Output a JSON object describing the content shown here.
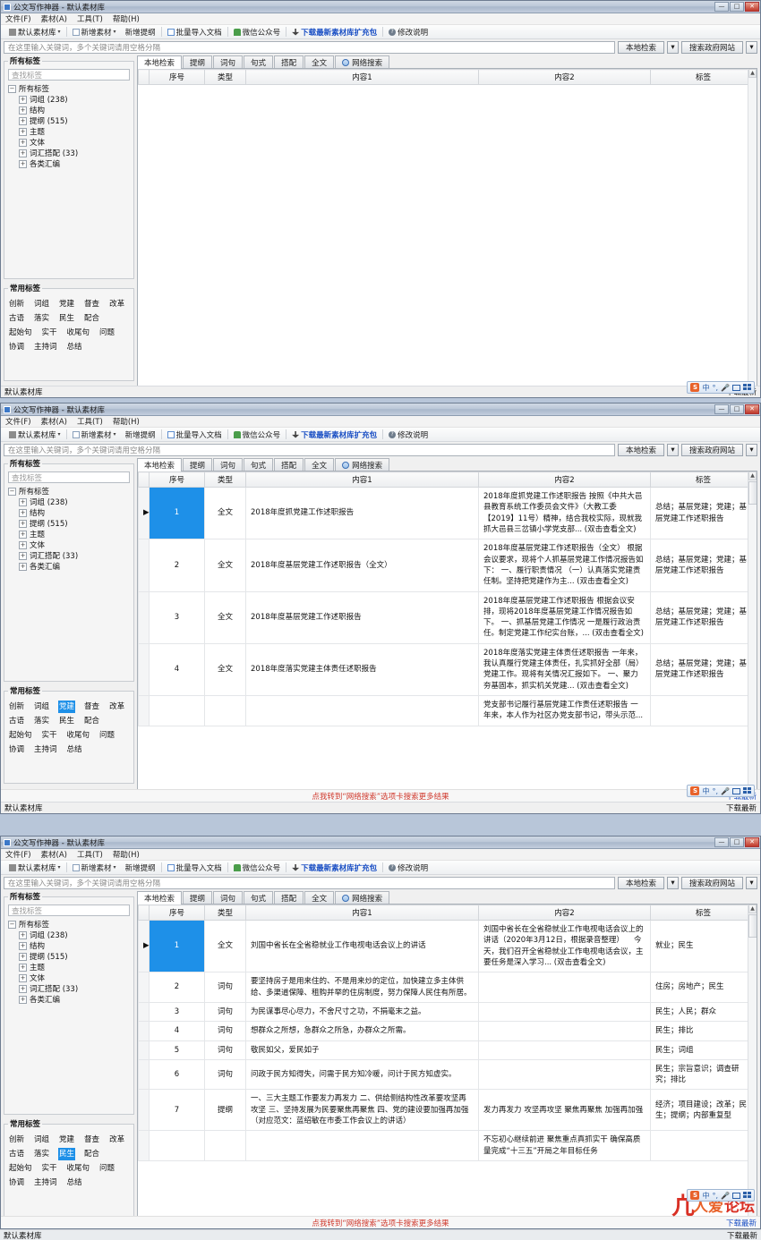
{
  "app": {
    "title": "公文写作神器 - 默认素材库",
    "window_buttons": {
      "minimize": "—",
      "maximize": "□",
      "close": "✕"
    }
  },
  "menu": {
    "items": [
      "文件(F)",
      "素材(A)",
      "工具(T)",
      "帮助(H)"
    ]
  },
  "toolbar": {
    "items": [
      {
        "label": "默认素材库",
        "icon": "library-icon",
        "caret": "▾"
      },
      {
        "label": "新增素材",
        "icon": "new-material-icon",
        "caret": "▾"
      },
      {
        "label": "新增提纲",
        "icon": "new-outline-icon",
        "caret": ""
      },
      {
        "label": "批量导入文档",
        "icon": "batch-import-icon",
        "caret": ""
      },
      {
        "label": "微信公众号",
        "icon": "wechat-icon",
        "caret": ""
      },
      {
        "label": "下载最新素材库扩充包",
        "icon": "download-icon",
        "caret": ""
      },
      {
        "label": "修改说明",
        "icon": "help-icon",
        "caret": ""
      }
    ]
  },
  "search": {
    "placeholder": "在这里输入关键词，多个关键词请用空格分隔",
    "value": "",
    "local_button": "本地检索",
    "gov_button": "搜索政府网站",
    "split_caret": "▾"
  },
  "sidebar": {
    "all_tags_title": "所有标签",
    "find_placeholder": "查找标签",
    "tree": {
      "root": {
        "label": "所有标签",
        "expander": "−"
      },
      "children": [
        {
          "label": "词组  (238)",
          "expander": "+"
        },
        {
          "label": "结构",
          "expander": "+"
        },
        {
          "label": "提纲  (515)",
          "expander": "+"
        },
        {
          "label": "主题",
          "expander": "+"
        },
        {
          "label": "文体",
          "expander": "+"
        },
        {
          "label": "词汇搭配  (33)",
          "expander": "+"
        },
        {
          "label": "各类汇编",
          "expander": "+"
        }
      ]
    },
    "common_title": "常用标签",
    "common_tags": [
      "创新",
      "词组",
      "党建",
      "督查",
      "改革",
      "古语",
      "落实",
      "民生",
      "配合",
      "起始句",
      "实干",
      "收尾句",
      "问题",
      "协调",
      "主持词",
      "总结"
    ],
    "selected_tag_win2": "党建",
    "selected_tag_win3": "民生"
  },
  "tabs": [
    {
      "label": "本地检索",
      "active": true,
      "icon": ""
    },
    {
      "label": "提纲",
      "active": false,
      "icon": ""
    },
    {
      "label": "词句",
      "active": false,
      "icon": ""
    },
    {
      "label": "句式",
      "active": false,
      "icon": ""
    },
    {
      "label": "搭配",
      "active": false,
      "icon": ""
    },
    {
      "label": "全文",
      "active": false,
      "icon": ""
    },
    {
      "label": "网络搜索",
      "active": false,
      "icon": "globe-icon"
    }
  ],
  "table": {
    "columns": [
      "序号",
      "类型",
      "内容1",
      "内容2",
      "标签"
    ]
  },
  "window1": {
    "rows": []
  },
  "window2": {
    "rows": [
      {
        "index": "1",
        "type": "全文",
        "content1": "2018年度抓党建工作述职报告",
        "content2": "2018年度抓党建工作述职报告\n按照《中共大邑县教育系统工作委员会文件》（大教工委【2019】11号）精神，结合我校实际，现就我抓大邑县三岔镇小学党支部...\n(双击查看全文)",
        "tags": "总结；基层党建；党建；基层党建工作述职报告",
        "selected": true
      },
      {
        "index": "2",
        "type": "全文",
        "content1": "2018年度基层党建工作述职报告（全文）",
        "content2": "2018年度基层党建工作述职报告（全文）\n根据会议要求，现将个人抓基层党建工作情况报告如下：\n一、履行职责情况\n（一）认真落实党建责任制。坚持把党建作为主...\n(双击查看全文)",
        "tags": "总结；基层党建；党建；基层党建工作述职报告",
        "selected": false
      },
      {
        "index": "3",
        "type": "全文",
        "content1": "2018年度基层党建工作述职报告",
        "content2": "2018年度基层党建工作述职报告\n根据会议安排，现将2018年度基层党建工作情况报告如下。\n一、抓基层党建工作情况\n一是履行政治责任。制定党建工作纪实台账，...\n(双击查看全文)",
        "tags": "总结；基层党建；党建；基层党建工作述职报告",
        "selected": false
      },
      {
        "index": "4",
        "type": "全文",
        "content1": "2018年度落实党建主体责任述职报告",
        "content2": "2018年度落实党建主体责任述职报告\n一年来，我认真履行党建主体责任，扎实抓好全部（局）党建工作。现将有关情况汇报如下。\n一、聚力夯基固本，抓实机关党建...\n(双击查看全文)",
        "tags": "总结；基层党建；党建；基层党建工作述职报告",
        "selected": false
      },
      {
        "index": "",
        "type": "",
        "content1": "",
        "content2": "党支部书记履行基层党建工作责任述职报告\n一年来，本人作为社区办党支部书记，带头示范...",
        "tags": "",
        "selected": false
      }
    ],
    "ad_text": "点我转到“网络搜索”选项卡搜索更多结果",
    "ad_right": "下载最新"
  },
  "window3": {
    "rows": [
      {
        "index": "1",
        "type": "全文",
        "content1": "刘国中省长在全省稳就业工作电视电话会议上的讲话",
        "content2": "刘国中省长在全省稳就业工作电视电话会议上的讲话（2020年3月12日，根据录音整理）\n　今天，我们召开全省稳就业工作电视电话会议，主要任务是深入学习...\n(双击查看全文)",
        "tags": "就业；民生",
        "selected": true
      },
      {
        "index": "2",
        "type": "词句",
        "content1": "要坚持房子是用来住的、不是用来炒的定位，加快建立多主体供给、多渠道保障、租购并举的住房制度，努力保障人民住有所居。",
        "content2": "",
        "tags": "住房；房地产；民生",
        "selected": false
      },
      {
        "index": "3",
        "type": "词句",
        "content1": "为民谋事尽心尽力，不舍尺寸之功，不捐毫末之益。",
        "content2": "",
        "tags": "民生；人民；群众",
        "selected": false
      },
      {
        "index": "4",
        "type": "词句",
        "content1": "想群众之所想，急群众之所急，办群众之所需。",
        "content2": "",
        "tags": "民生；排比",
        "selected": false
      },
      {
        "index": "5",
        "type": "词句",
        "content1": "敬民如父，爱民如子",
        "content2": "",
        "tags": "民生；词组",
        "selected": false
      },
      {
        "index": "6",
        "type": "词句",
        "content1": "问政于民方知得失，问需于民方知冷暖，问计于民方知虚实。",
        "content2": "",
        "tags": "民生；宗旨意识；调查研究；排比",
        "selected": false
      },
      {
        "index": "7",
        "type": "提纲",
        "content1": "一、三大主题工作要发力再发力\n二、供给侧结构性改革要攻坚再攻坚\n三、坚持发展为民要聚焦再聚焦\n四、党的建设要加强再加强\n\n（对应范文：蓝绍敏在市委工作会议上的讲话）",
        "content2": "发力再发力\n攻坚再攻坚\n聚焦再聚焦\n加强再加强",
        "tags": "经济；项目建设；改革；民生；提纲；内部重复型",
        "selected": false
      },
      {
        "index": "",
        "type": "",
        "content1": "",
        "content2": "不忘初心继续前进 聚焦重点真抓实干\n确保高质量完成“十三五”开局之年目标任务",
        "tags": "",
        "selected": false
      }
    ],
    "ad_text": "点我转到“网络搜索”选项卡搜索更多结果",
    "ad_right": "下载最新"
  },
  "statusbar": {
    "left": "默认素材库",
    "right": "下载最新"
  },
  "ime": {
    "logo": "S",
    "items": [
      "中",
      "°,",
      "mic-icon",
      "keyboard-icon",
      "grid-icon"
    ]
  },
  "watermark": {
    "mark": "凣",
    "text1": "人爱",
    "text2": "论坛"
  },
  "scrollbar": {
    "up": "▲",
    "down": "▼"
  }
}
